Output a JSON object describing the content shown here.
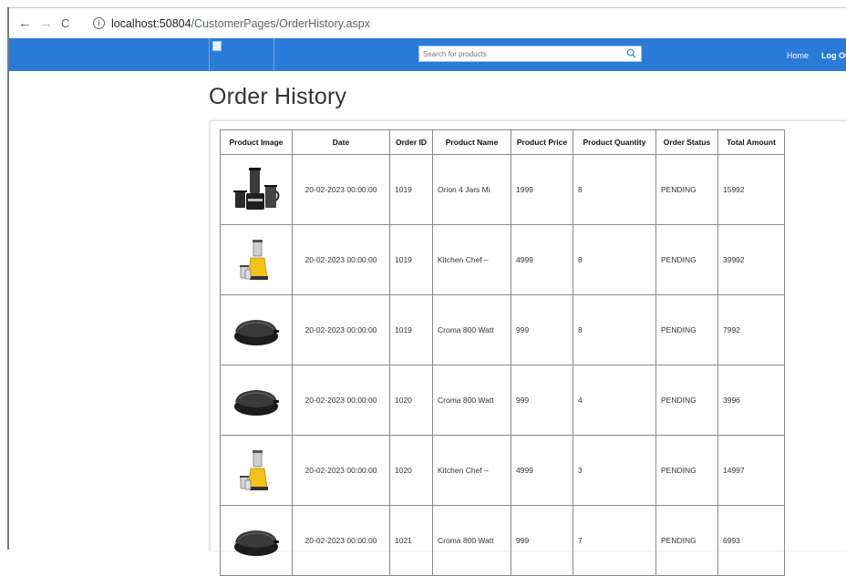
{
  "browser": {
    "back_icon": "←",
    "forward_icon": "→",
    "reload_icon": "C",
    "info_icon": "i",
    "url_host": "localhost:50804",
    "url_path": "/CustomerPages/OrderHistory.aspx"
  },
  "header": {
    "search_placeholder": "Search for products",
    "nav_home": "Home",
    "nav_logout": "Log Out",
    "bar_color": "#2a7ad8"
  },
  "page": {
    "title": "Order History"
  },
  "table": {
    "columns": [
      "Product Image",
      "Date",
      "Order ID",
      "Product Name",
      "Product Price",
      "Product Quantity",
      "Order Status",
      "Total Amount"
    ],
    "rows": [
      {
        "image": "mixer-grinder-black",
        "date": "20-02-2023 00:00:00",
        "order_id": "1019",
        "name": "Orion 4 Jars Mi",
        "price": "1999",
        "quantity": "8",
        "status": "PENDING",
        "total": "15992"
      },
      {
        "image": "mixer-grinder-yellow",
        "date": "20-02-2023 00:00:00",
        "order_id": "1019",
        "name": "Kitchen Chef –",
        "price": "4999",
        "quantity": "8",
        "status": "PENDING",
        "total": "39992"
      },
      {
        "image": "sandwich-maker",
        "date": "20-02-2023 00:00:00",
        "order_id": "1019",
        "name": "Croma 800 Watt",
        "price": "999",
        "quantity": "8",
        "status": "PENDING",
        "total": "7992"
      },
      {
        "image": "sandwich-maker",
        "date": "20-02-2023 00:00:00",
        "order_id": "1020",
        "name": "Croma 800 Watt",
        "price": "999",
        "quantity": "4",
        "status": "PENDING",
        "total": "3996"
      },
      {
        "image": "mixer-grinder-yellow",
        "date": "20-02-2023 00:00:00",
        "order_id": "1020",
        "name": "Kitchen Chef –",
        "price": "4999",
        "quantity": "3",
        "status": "PENDING",
        "total": "14997"
      },
      {
        "image": "sandwich-maker",
        "date": "20-02-2023 00:00:00",
        "order_id": "1021",
        "name": "Croma 800 Watt",
        "price": "999",
        "quantity": "7",
        "status": "PENDING",
        "total": "6993"
      }
    ]
  }
}
